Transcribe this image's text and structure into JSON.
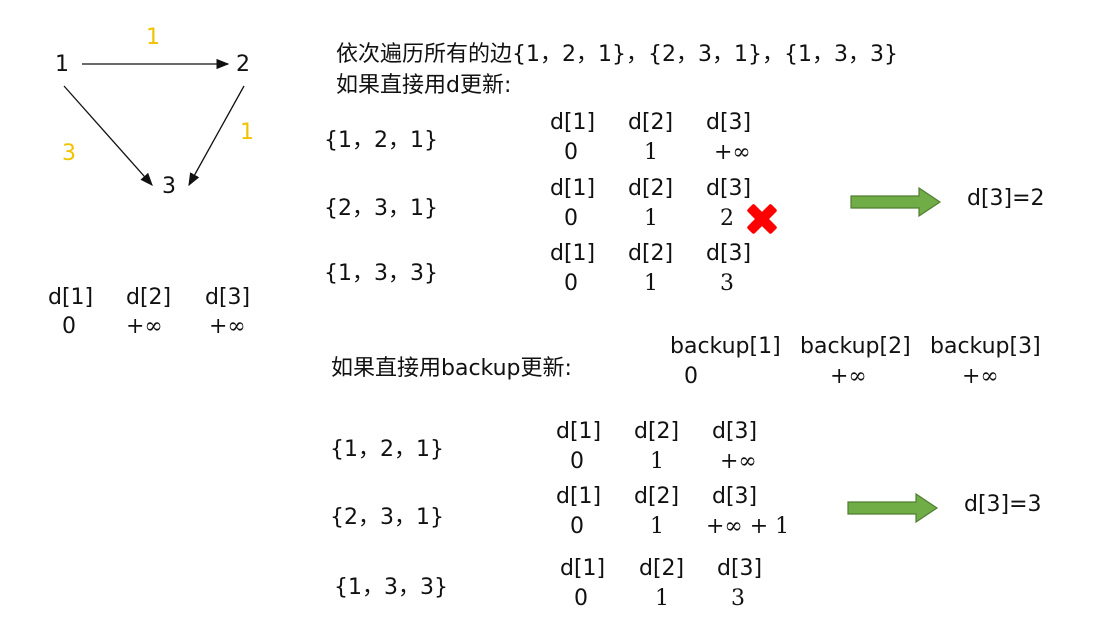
{
  "graph": {
    "nodes": [
      "1",
      "2",
      "3"
    ],
    "edges": [
      {
        "from": "1",
        "to": "2",
        "w": "1"
      },
      {
        "from": "2",
        "to": "3",
        "w": "1"
      },
      {
        "from": "1",
        "to": "3",
        "w": "3"
      }
    ]
  },
  "init": {
    "h1": "d[1]",
    "h2": "d[2]",
    "h3": "d[3]",
    "v1": "0",
    "v2": "+∞",
    "v3": "+∞"
  },
  "intro_line1": "依次遍历所有的边{1，2，1}，{2，3，1}，{1，3，3}",
  "intro_line2": "如果直接用d更新:",
  "section_d": {
    "rows": [
      {
        "edge": "{1，2，1}",
        "h1": "d[1]",
        "h2": "d[2]",
        "h3": "d[3]",
        "v1": "0",
        "v2": "1",
        "v3": "+∞"
      },
      {
        "edge": "{2，3，1}",
        "h1": "d[1]",
        "h2": "d[2]",
        "h3": "d[3]",
        "v1": "0",
        "v2": "1",
        "v3": "2"
      },
      {
        "edge": "{1，3，3}",
        "h1": "d[1]",
        "h2": "d[2]",
        "h3": "d[3]",
        "v1": "0",
        "v2": "1",
        "v3": "3"
      }
    ],
    "result": "d[3]=2"
  },
  "backup_title": "如果直接用backup更新:",
  "backup_header": {
    "h1": "backup[1]",
    "h2": "backup[2]",
    "h3": "backup[3]",
    "v1": "0",
    "v2": "+∞",
    "v3": "+∞"
  },
  "section_backup": {
    "rows": [
      {
        "edge": "{1，2，1}",
        "h1": "d[1]",
        "h2": "d[2]",
        "h3": "d[3]",
        "v1": "0",
        "v2": "1",
        "v3": "+∞"
      },
      {
        "edge": "{2，3，1}",
        "h1": "d[1]",
        "h2": "d[2]",
        "h3": "d[3]",
        "v1": "0",
        "v2": "1",
        "v3": "+∞ + 1"
      },
      {
        "edge": "{1，3，3}",
        "h1": "d[1]",
        "h2": "d[2]",
        "h3": "d[3]",
        "v1": "0",
        "v2": "1",
        "v3": "3"
      }
    ],
    "result": "d[3]=3"
  },
  "colors": {
    "weight": "#f2c200",
    "arrow_fill": "#70ad47",
    "arrow_stroke": "#507e32",
    "cross": "#ff0000"
  }
}
